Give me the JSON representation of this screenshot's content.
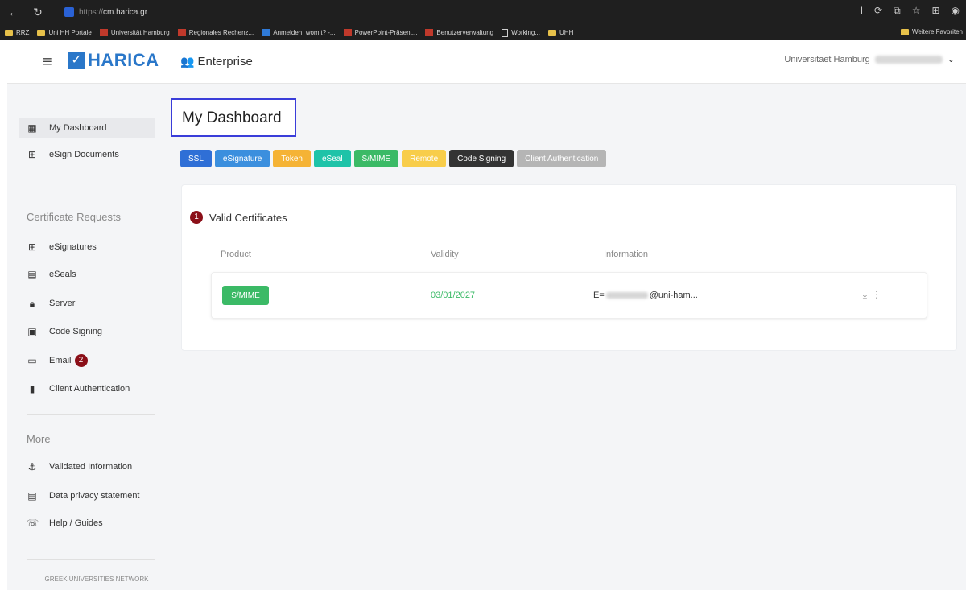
{
  "browser": {
    "url_protocol": "https://",
    "url_host": "cm.harica.gr",
    "bookmarks": [
      {
        "label": "RRZ",
        "icon": "folder"
      },
      {
        "label": "Uni HH Portale",
        "icon": "folder"
      },
      {
        "label": "Universität Hamburg",
        "icon": "red"
      },
      {
        "label": "Regionales Rechenz...",
        "icon": "red"
      },
      {
        "label": "Anmelden, womit? -...",
        "icon": "blue"
      },
      {
        "label": "PowerPoint-Präsent...",
        "icon": "red"
      },
      {
        "label": "Benutzerverwaltung",
        "icon": "red"
      },
      {
        "label": "Working...",
        "icon": "page"
      },
      {
        "label": "UHH",
        "icon": "folder"
      }
    ],
    "bookmarks_right": "Weitere Favoriten"
  },
  "header": {
    "logo_text": "HARICA",
    "logo_mark": "✓",
    "context": "Enterprise",
    "user_org": "Universitaet Hamburg"
  },
  "sidebar": {
    "top_items": [
      {
        "label": "My Dashboard",
        "icon": "dashboard-icon"
      },
      {
        "label": "eSign Documents",
        "icon": "esign-icon"
      }
    ],
    "section_requests": "Certificate Requests",
    "request_items": [
      {
        "label": "eSignatures",
        "icon": "esign-icon"
      },
      {
        "label": "eSeals",
        "icon": "seal-icon"
      },
      {
        "label": "Server",
        "icon": "lock-icon"
      },
      {
        "label": "Code Signing",
        "icon": "code-icon"
      },
      {
        "label": "Email",
        "icon": "email-icon",
        "badge": "2"
      },
      {
        "label": "Client Authentication",
        "icon": "client-icon"
      }
    ],
    "section_more": "More",
    "more_items": [
      {
        "label": "Validated Information",
        "icon": "validated-icon"
      },
      {
        "label": "Data privacy statement",
        "icon": "privacy-icon"
      },
      {
        "label": "Help / Guides",
        "icon": "help-icon"
      }
    ],
    "footer": "GREEK UNIVERSITIES NETWORK"
  },
  "main": {
    "title": "My Dashboard",
    "tabs": [
      {
        "label": "SSL",
        "color": "#2f6fd6"
      },
      {
        "label": "eSignature",
        "color": "#3b8fde"
      },
      {
        "label": "Token",
        "color": "#f5b335"
      },
      {
        "label": "eSeal",
        "color": "#1ec3a8"
      },
      {
        "label": "S/MIME",
        "color": "#3bba66"
      },
      {
        "label": "Remote",
        "color": "#f8cd4a"
      },
      {
        "label": "Code Signing",
        "color": "#333333"
      },
      {
        "label": "Client Authentication",
        "color": "#b5b5b5"
      }
    ],
    "card": {
      "badge": "1",
      "heading": "Valid Certificates",
      "columns": {
        "product": "Product",
        "validity": "Validity",
        "information": "Information"
      },
      "row": {
        "product": "S/MIME",
        "validity": "03/01/2027",
        "info_prefix": "E=",
        "info_suffix": "@uni-ham..."
      }
    }
  }
}
